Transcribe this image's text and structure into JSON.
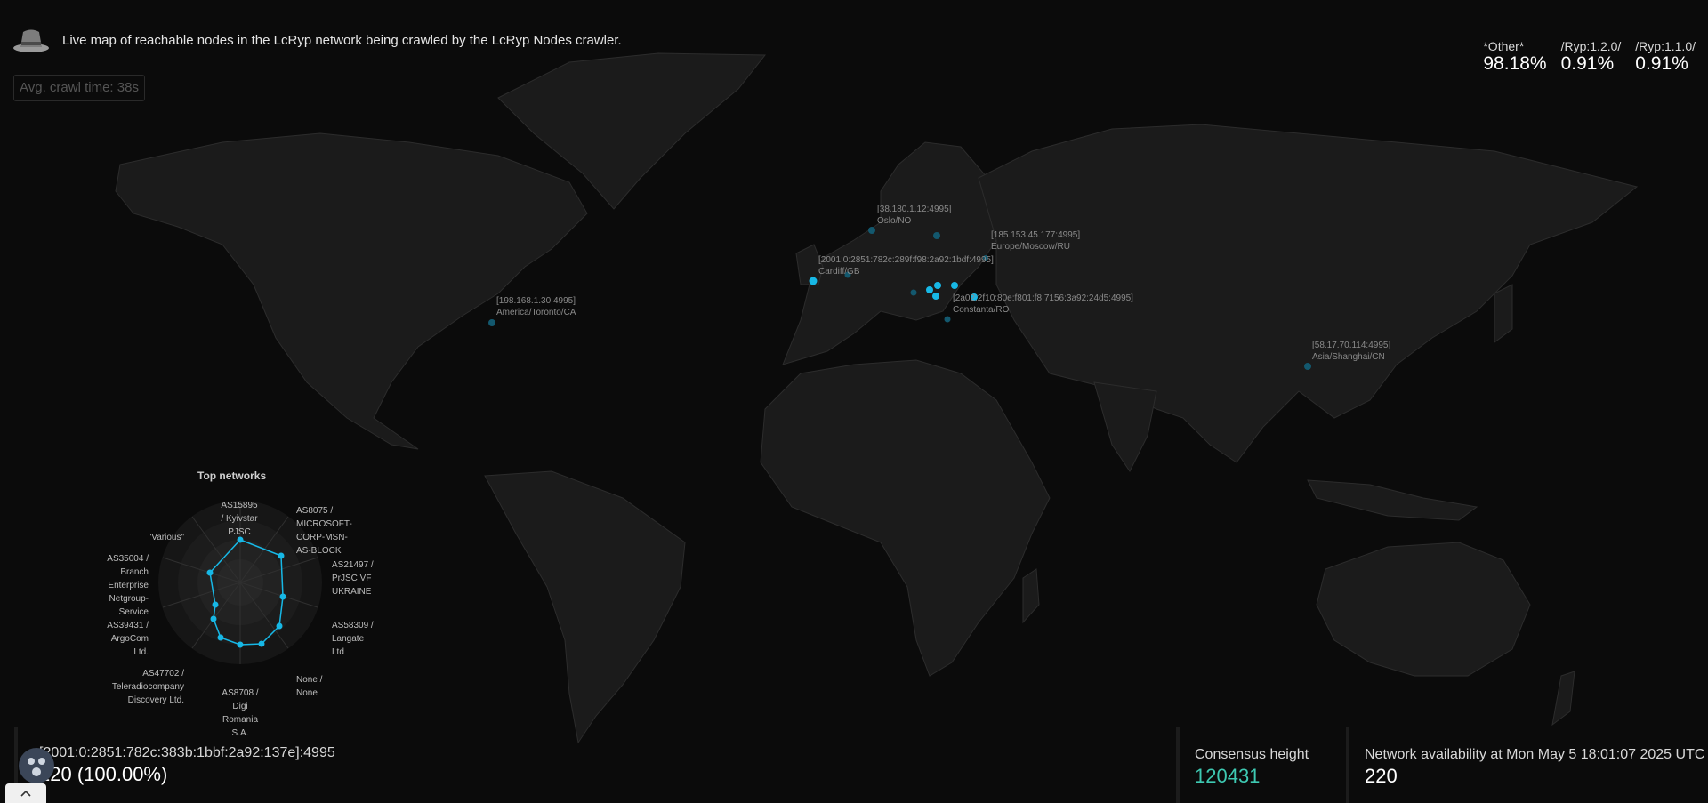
{
  "header": {
    "icon": "spy-hat-icon",
    "text": "Live map of reachable nodes in the LcRyp network being crawled by the LcRyp Nodes crawler."
  },
  "crawl": {
    "text": "Avg. crawl time: 38s"
  },
  "user_agents": [
    {
      "name": "*Other*",
      "percent": "98.18%"
    },
    {
      "name": "/Ryp:1.2.0/",
      "percent": "0.91%"
    },
    {
      "name": "/Ryp:1.1.0/",
      "percent": "0.91%"
    }
  ],
  "nodes": [
    {
      "address": "[38.180.1.12:4995]",
      "location": "Oslo/NO"
    },
    {
      "address": "[185.153.45.177:4995]",
      "location": "Europe/Moscow/RU"
    },
    {
      "address": "[2001:0:2851:782c:289f:f98:2a92:1bdf:4995]",
      "location": "Cardiff/GB"
    },
    {
      "address": "[198.168.1.30:4995]",
      "location": "America/Toronto/CA"
    },
    {
      "address": "[2a02:2f10:80e:f801:f8:7156:3a92:24d5:4995]",
      "location": "Constanta/RO"
    },
    {
      "address": "[58.17.70.114:4995]",
      "location": "Asia/Shanghai/CN"
    }
  ],
  "top_networks": {
    "title": "Top networks",
    "labels": [
      "AS15895 / Kyivstar PJSC",
      "AS8075 / MICROSOFT-CORP-MSN-AS-BLOCK",
      "AS21497 / PrJSC VF UKRAINE",
      "AS58309 / Langate Ltd",
      "None / None",
      "AS8708 / Digi Romania S.A.",
      "AS47702 / Teleradiocompany Discovery Ltd.",
      "AS39431 / ArgoCom Ltd.",
      "AS35004 / Branch Enterprise Netgroup-Service",
      "\"Various\""
    ]
  },
  "selected_node": {
    "address": "[2001:0:2851:782c:383b:1bbf:2a92:137e]:4995",
    "value": "220 (100.00%)"
  },
  "consensus": {
    "label": "Consensus height",
    "value": "120431"
  },
  "availability": {
    "label": "Network availability at Mon May 5 18:01:07 2025 UTC",
    "value": "220"
  },
  "colors": {
    "accent": "#17b8e6",
    "green": "#3ec9b2",
    "land": "#1a1a1a",
    "ocean": "#0b0b0b"
  }
}
